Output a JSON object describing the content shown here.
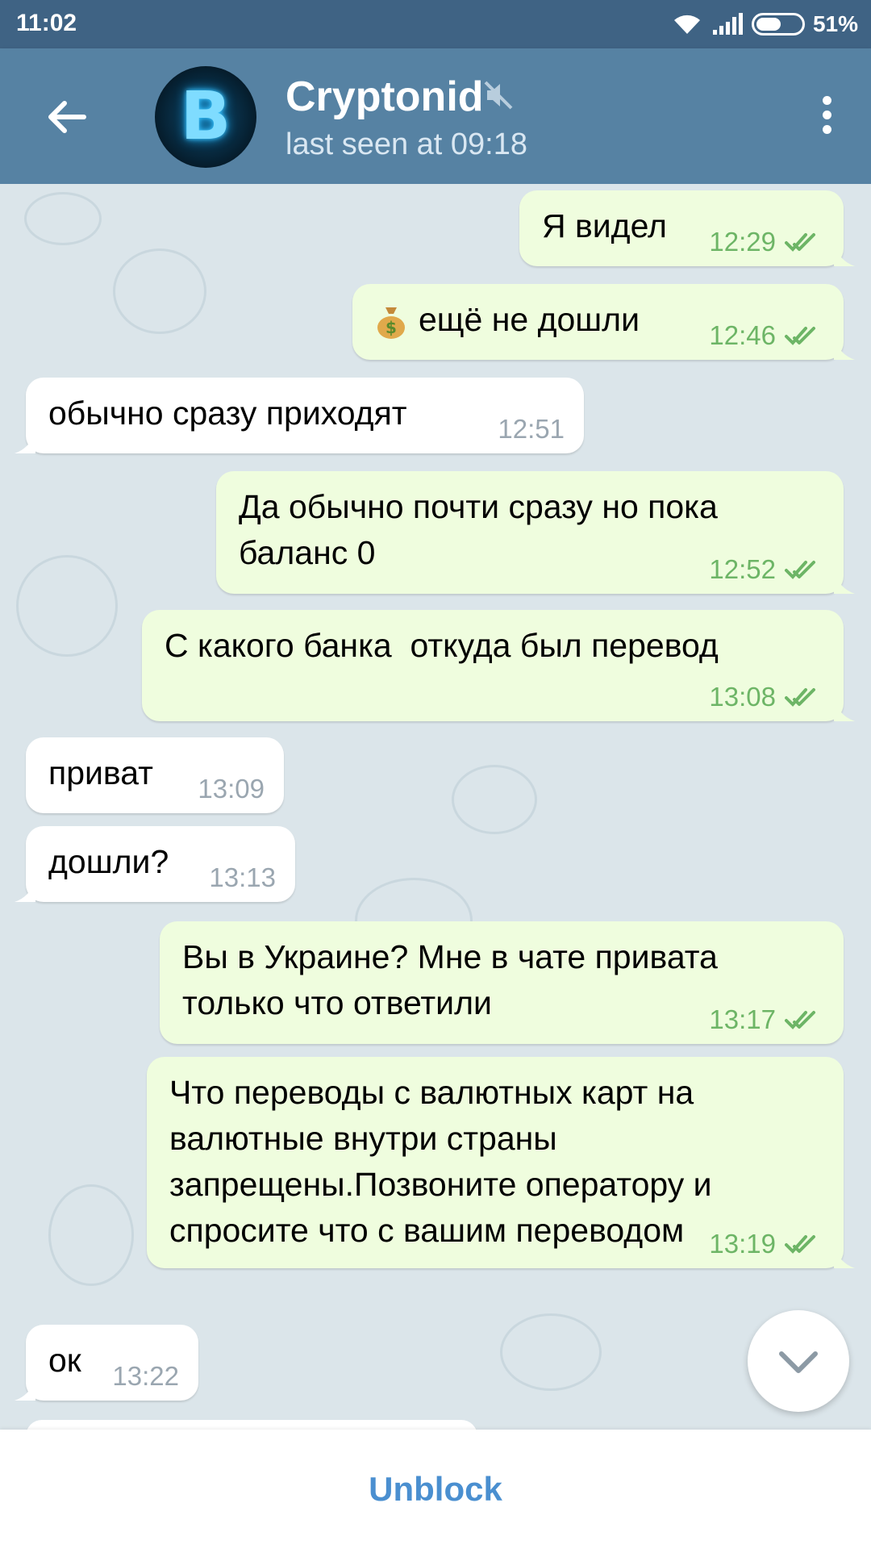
{
  "status_bar": {
    "time": "11:02",
    "battery": "51%"
  },
  "header": {
    "title": "Cryptonid",
    "subtitle": "last seen at 09:18",
    "avatar_glyph": "B"
  },
  "messages": [
    {
      "dir": "out",
      "text": "Я видел",
      "time": "12:29"
    },
    {
      "dir": "out",
      "text": "ещё не дошли",
      "time": "12:46",
      "emoji": "money-bag"
    },
    {
      "dir": "in",
      "text": "обычно сразу приходят",
      "time": "12:51"
    },
    {
      "dir": "out",
      "lines": [
        "Да обычно почти сразу но пока",
        "баланс 0"
      ],
      "time": "12:52"
    },
    {
      "dir": "out",
      "text": "С какого банка  откуда был перевод",
      "time": "13:08"
    },
    {
      "dir": "in",
      "text": "приват",
      "time": "13:09"
    },
    {
      "dir": "in",
      "text": "дошли?",
      "time": "13:13"
    },
    {
      "dir": "out",
      "lines": [
        "Вы в Украине? Мне в чате привата",
        "только что ответили"
      ],
      "time": "13:17"
    },
    {
      "dir": "out",
      "lines": [
        "Что переводы с валютных карт на",
        "валютные внутри страны",
        "запрещены.Позвоните оператору и",
        "спросите что с вашим переводом"
      ],
      "time": "13:19"
    },
    {
      "dir": "in",
      "text": "ок",
      "time": "13:22"
    }
  ],
  "bottom": {
    "unblock_label": "Unblock"
  },
  "colors": {
    "header": "#5682a3",
    "status_bar": "#3f6384",
    "outgoing_bubble": "#effdde",
    "incoming_bubble": "#ffffff",
    "check_marks": "#6db566",
    "unblock": "#4a8fd0"
  }
}
